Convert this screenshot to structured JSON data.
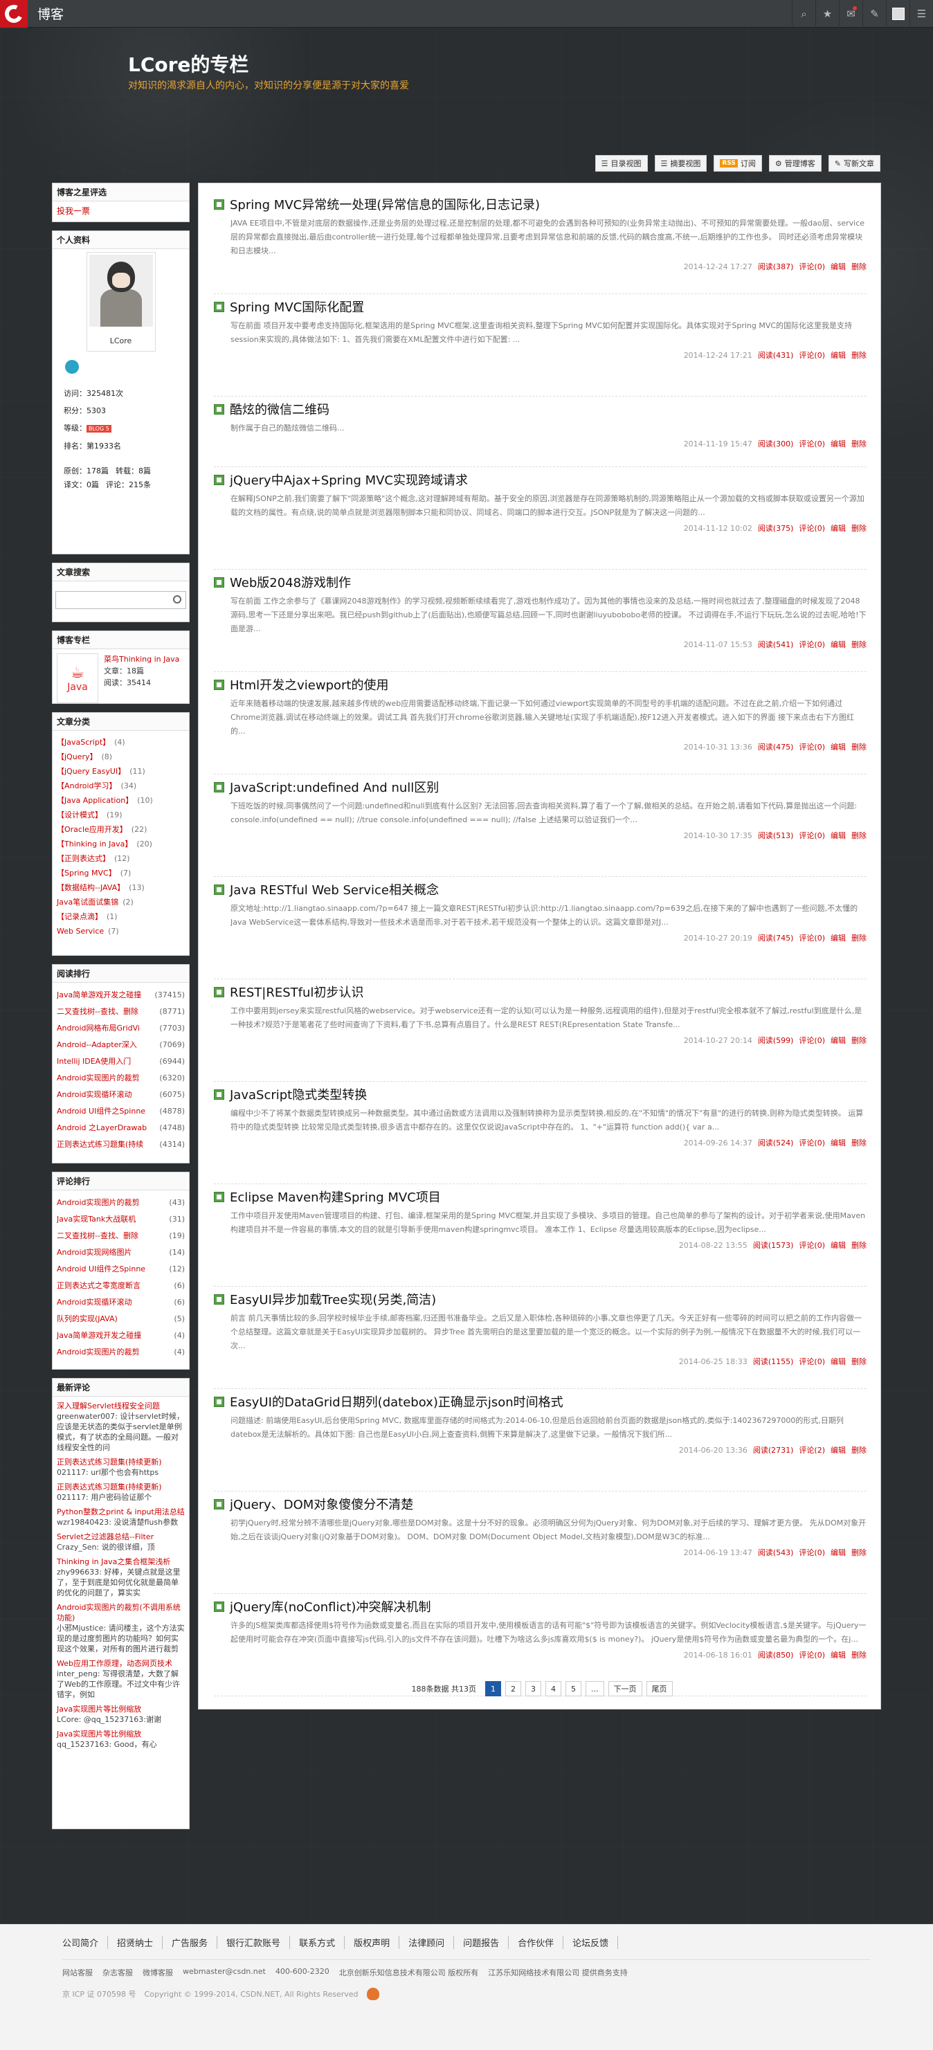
{
  "topbar": {
    "brand": "博客"
  },
  "header": {
    "title": "LCore的专栏",
    "subtitle": "对知识的渴求源自人的内心，对知识的分享便是源于对大家的喜爱"
  },
  "nav": [
    "目录视图",
    "摘要视图",
    "订阅",
    "管理博客",
    "写新文章"
  ],
  "nav_rss": "RSS",
  "side": {
    "award_title": "博客之星评选",
    "award_link": "投我一票",
    "profile_title": "个人资料",
    "username": "LCore",
    "stats": [
      [
        "访问：",
        "325481次"
      ],
      [
        "积分：",
        "5303"
      ],
      [
        "等级：",
        "BLOG 5"
      ],
      [
        "排名：",
        "第1933名"
      ]
    ],
    "stats2": [
      [
        "原创：",
        "178篇",
        "转载：",
        "8篇"
      ],
      [
        "译文：",
        "0篇",
        "评论：",
        "215条"
      ]
    ],
    "search_title": "文章搜索",
    "column_title": "博客专栏",
    "column_name": "菜鸟Thinking in Java",
    "column_count": "文章：18篇",
    "column_read": "阅读：35414",
    "column_logo": "Java",
    "cat_title": "文章分类",
    "cats": [
      [
        "【JavaScript】",
        "(4)"
      ],
      [
        "【jQuery】",
        "(8)"
      ],
      [
        "【jQuery EasyUI】",
        "(11)"
      ],
      [
        "【Android学习】",
        "(34)"
      ],
      [
        "【Java Application】",
        "(10)"
      ],
      [
        "【设计模式】",
        "(19)"
      ],
      [
        "【Oracle应用开发】",
        "(22)"
      ],
      [
        "【Thinking in Java】",
        "(20)"
      ],
      [
        "【正则表达式】",
        "(12)"
      ],
      [
        "【Spring MVC】",
        "(7)"
      ],
      [
        "【数据结构--JAVA】",
        "(13)"
      ],
      [
        "Java笔试面试集锦",
        "(2)"
      ],
      [
        "【记录点滴】",
        "(1)"
      ],
      [
        "Web Service",
        "(7)"
      ]
    ],
    "rank_title": "阅读排行",
    "ranks": [
      [
        "Java简单游戏开发之碰撞",
        "(37415)"
      ],
      [
        "二叉查找树--查找、删除",
        "(8771)"
      ],
      [
        "Android网格布局GridVi",
        "(7703)"
      ],
      [
        "Android--Adapter深入",
        "(7069)"
      ],
      [
        "Intellij IDEA使用入门",
        "(6944)"
      ],
      [
        "Android实现图片的裁剪",
        "(6320)"
      ],
      [
        "Android实现循环滚动",
        "(6075)"
      ],
      [
        "Android UI组件之Spinne",
        "(4878)"
      ],
      [
        "Android 之LayerDrawab",
        "(4748)"
      ],
      [
        "正则表达式练习题集(持续",
        "(4314)"
      ]
    ],
    "crank_title": "评论排行",
    "cranks": [
      [
        "Android实现图片的裁剪",
        "(43)"
      ],
      [
        "Java实现Tank大战联机",
        "(31)"
      ],
      [
        "二叉查找树--查找、删除",
        "(19)"
      ],
      [
        "Android实现网络图片",
        "(14)"
      ],
      [
        "Android UI组件之Spinne",
        "(12)"
      ],
      [
        "正则表达式之零宽度断言",
        "(6)"
      ],
      [
        "Android实现循环滚动",
        "(6)"
      ],
      [
        "队列的实现(JAVA)",
        "(5)"
      ],
      [
        "Java简单游戏开发之碰撞",
        "(4)"
      ],
      [
        "Android实现图片的裁剪",
        "(4)"
      ]
    ],
    "cmt_title": "最新评论",
    "comments": [
      [
        "深入理解Servlet线程安全问题",
        "greenwater007: 设计servlet时候，应该是无状态的类似于servlet是单例模式，有了状态的全局问题。一般对线程安全性的问"
      ],
      [
        "正则表达式练习题集(持续更新)",
        "021117: url那个也会有https"
      ],
      [
        "正则表达式练习题集(持续更新)",
        "021117: 用户密码验证那个"
      ],
      [
        "Python整数之print & input用法总结",
        "wzr19840423: 没说清楚flush参数"
      ],
      [
        "Servlet之过滤器总结--Filter",
        "Crazy_Sen: 说的很详细，顶"
      ],
      [
        "Thinking in Java之集合框架浅析",
        "zhy996633: 好棒，关键点就是这里了，至于到底是如何优化就是最简单的优化的问题了，算实实"
      ],
      [
        "Android实现图片的裁剪(不调用系统功能)",
        "小邪Mjustice: 请问楼主，这个方法实现的是过度剪图片的功能吗？如何实现这个效果，对所有的图片进行裁剪"
      ],
      [
        "Web应用工作原理，动态网页技术",
        "inter_peng: 写得很清楚，大数了解了Web的工作原理。不过文中有少许错字，例如"
      ],
      [
        "Java实现图片等比例缩放",
        "LCore: @qq_15237163:谢谢"
      ],
      [
        "Java实现图片等比例缩放",
        "qq_15237163: Good，有心"
      ]
    ]
  },
  "articles": [
    {
      "title": "Spring MVC异常统一处理(异常信息的国际化,日志记录)",
      "excerpt": "JAVA EE项目中,不管是对底层的数据操作,还是业务层的处理过程,还是控制层的处理,都不可避免的会遇到各种可预知的(业务异常主动抛出)、不可预知的异常需要处理。一般dao层、service层的异常都会直接抛出,最后由controller统一进行处理,每个过程都单独处理异常,且要考虑到异常信息和前端的反馈,代码的耦合度高,不统一,后期维护的工作也多。     同时还必须考虑异常模块和日志模块...",
      "date": "2014-12-24 17:27",
      "read": "阅读(387)",
      "comment": "评论(0)"
    },
    {
      "title": "Spring MVC国际化配置",
      "excerpt": "写在前面       项目开发中要考虑支持国际化,框架选用的是Spring MVC框架,这里查询相关资料,整理下Spring MVC如何配置并实现国际化。具体实现对于Spring MVC的国际化这里我是支持session来实现的,具体做法如下:       1、首先我们需要在XML配置文件中进行如下配置: ...",
      "date": "2014-12-24 17:21",
      "read": "阅读(431)",
      "comment": "评论(0)"
    },
    {
      "title": "酷炫的微信二维码",
      "excerpt": "制作属于自己的酷炫微信二维码...",
      "date": "2014-11-19 15:47",
      "read": "阅读(300)",
      "comment": "评论(0)"
    },
    {
      "title": "jQuery中Ajax+Spring MVC实现跨域请求",
      "excerpt": "在解释JSONP之前,我们需要了解下\"同源策略\"这个概念,这对理解跨域有帮助。基于安全的原因,浏览器是存在同源策略机制的,同源策略阻止从一个源加载的文档或脚本获取或设置另一个源加载的文档的属性。有点绕,说的简单点就是浏览器限制脚本只能和同协议、同域名、同端口的脚本进行交互。JSONP就是为了解决这一问题的...",
      "date": "2014-11-12 10:02",
      "read": "阅读(375)",
      "comment": "评论(0)"
    },
    {
      "title": "Web版2048游戏制作",
      "excerpt": "写在前面         工作之余参与了《慕课网2048游戏制作》的学习视频,视频断断续续看完了,游戏也制作成功了。因为其他的事情也没来的及总结,一拖时间也就过去了,整理磁盘的时候发现了2048源码,思考一下还是分享出来吧。我已经push到github上了(后面贴出),也顺便写篇总结,回顾一下,同时也谢谢liuyubobobo老师的授课。       不过调得在手,不运行下玩玩,怎么说的过去呢,哈哈!下面是游...",
      "date": "2014-11-07 15:53",
      "read": "阅读(541)",
      "comment": "评论(0)"
    },
    {
      "title": "Html开发之viewport的使用",
      "excerpt": "近年来随着移动端的快速发展,越来越多传统的web应用需要适配移动终端,下面记录一下如何通过viewport实现简单的不同型号的手机端的适配问题。不过在此之前,介绍一下如何通过Chrome浏览器,调试在移动终端上的效果。调试工具       首先我们打开chrome谷歌浏览器,输入关键地址(实现了手机端适配),按F12进入开发者模式。进入如下的界面       接下来点击右下方图红的...",
      "date": "2014-10-31 13:36",
      "read": "阅读(475)",
      "comment": "评论(0)"
    },
    {
      "title": "JavaScript:undefined And null区别",
      "excerpt": "下班吃饭的时候,同事偶然问了一个问题:undefined和null到底有什么区别? 无法回答,回去查询相关资料,算了看了一个了解,做相关的总结。在开始之前,请看如下代码,算是抛出这一个问题: console.info(undefined == null); //true console.info(undefined === null); //false       上述结果可以验证我们一个...",
      "date": "2014-10-30 17:35",
      "read": "阅读(513)",
      "comment": "评论(0)"
    },
    {
      "title": "Java RESTful Web Service相关概念",
      "excerpt": "原文地址:http://1.liangtao.sinaapp.com/?p=647       接上一篇文章REST|RESTful初步认识:http://1.liangtao.sinaapp.com/?p=639之后,在接下来的了解中也遇到了一些问题,不太懂的Java WebService这一套体系结构,导致对一些技术术语是而非,对于若干技术,若干规范没有一个整体上的认识。这篇文章即是对J...",
      "date": "2014-10-27 20:19",
      "read": "阅读(745)",
      "comment": "评论(0)"
    },
    {
      "title": "REST|RESTful初步认识",
      "excerpt": "工作中要用到jersey来实现restful风格的webservice。对于webservice还有一定的认知(可以认为是一种服务,远程调用的组件),但是对于restful完全根本就不了解过,restful到底是什么,是一种技术?规范?于是笔者花了些时间查询了下资料,看了下书,总算有点眉目了。什么是REST REST(REpresentation State Transfe...",
      "date": "2014-10-27 20:14",
      "read": "阅读(599)",
      "comment": "评论(0)"
    },
    {
      "title": "JavaScript隐式类型转换",
      "excerpt": "编程中少不了将某个数据类型转换成另一种数据类型。其中通过函数或方法调用以及强制转换称为显示类型转换,相反的,在\"不知情\"的情况下\"有意\"的进行的转换,则称为隐式类型转换。     运算符中的隐式类型转换       比较常见隐式类型转换,很多语言中都存在的。这里仅仅说说JavaScript中存在的。         1、\"+\"运算符 function add(){ var a...",
      "date": "2014-09-26 14:37",
      "read": "阅读(524)",
      "comment": "评论(0)"
    },
    {
      "title": "Eclipse Maven构建Spring MVC项目",
      "excerpt": "工作中项目开发使用Maven管理项目的构建、打包、编译,框架采用的是Spring MVC框架,并且实现了多模块、多项目的管理。自己也简单的参与了架构的设计。对于初学者来说,使用Maven构建项目并不是一件容易的事情,本文的目的就是引导新手使用maven构建springmvc项目。 准本工作       1、Eclipse         尽量选用较高版本的Eclipse,因为eclipse...",
      "date": "2014-08-22 13:55",
      "read": "阅读(1573)",
      "comment": "评论(0)"
    },
    {
      "title": "EasyUI异步加载Tree实现(另类,简洁)",
      "excerpt": "前言       前几天事情比较的多,回学校时候毕业手续,邮寄档案,归还图书准备毕业。之后又是入职体检,各种琐碎的小事,文章也停更了几天。今天正好有一些零碎的时间可以把之前的工作内容做一个总结整理。这篇文章就是关于EasyUI实现异步加载树的。     异步Tree       首先需明白的是这里要加载的是一个宽泛的概念。以一个实际的例子为例,一般情况下在数据量不大的时候,我们可以一次...",
      "date": "2014-06-25 18:33",
      "read": "阅读(1155)",
      "comment": "评论(0)"
    },
    {
      "title": "EasyUI的DataGrid日期列(datebox)正确显示json时间格式",
      "excerpt": "问题描述:       前端使用EasyUI,后台使用Spring MVC, 数据库里面存储的时间格式为:2014-06-10,但是后台返回给前台页面的数据是json格式的,类似于:1402367297000的形式,日期列datebox是无法解析的。具体如下图:       自己也是EasyUI小白,网上查查资料,倒腾下来算是解决了,这里做下记录。一般情况下我们所...",
      "date": "2014-06-20 13:36",
      "read": "阅读(2731)",
      "comment": "评论(2)"
    },
    {
      "title": "jQuery、DOM对象傻傻分不清楚",
      "excerpt": "初学jQuery时,经常分辨不清哪些是jQuery对象,哪些是DOM对象。这是十分不好的现象。必须明确区分何为jQuery对象、何为DOM对象,对于后续的学习、理解才更方便。       先从DOM对象开始,之后在谈谈jQuery对象(jQ对象基于DOM对象)。     DOM、DOM对象           DOM(Document Object Model,文档对象模型),DOM是W3C的标准...",
      "date": "2014-06-19 13:47",
      "read": "阅读(543)",
      "comment": "评论(0)"
    },
    {
      "title": "jQuery库(noConflict)冲突解决机制",
      "excerpt": "许多的JS框架类库都选择使用$符号作为函数或变量名,而且在实际的项目开发中,使用模板语言的话有可能\"$\"符号即为该模板语言的关键字。例如Veclocity模板语言,$是关键字。与jQuery一起使用时可能会存在冲突(页面中直接写js代码,引入的js文件不存在该问题)。吐槽下为啥这么多js库喜欢用$($ is money?)。       jQuery是使用$符号作为函数或变量名最为典型的一个。在j...",
      "date": "2014-06-18 16:01",
      "read": "阅读(850)",
      "comment": "评论(0)"
    }
  ],
  "article_edit": "编辑",
  "article_delete": "删除",
  "pager": {
    "summary": "188条数据 共13页",
    "pages": [
      "1",
      "2",
      "3",
      "4",
      "5",
      "...",
      "下一页",
      "尾页"
    ]
  },
  "footer": {
    "links": [
      "公司简介",
      "招贤纳士",
      "广告服务",
      "银行汇款账号",
      "联系方式",
      "版权声明",
      "法律顾问",
      "问题报告",
      "合作伙伴",
      "论坛反馈"
    ],
    "contact": [
      "网站客服",
      "杂志客服",
      "微博客服",
      "webmaster@csdn.net",
      "400-600-2320",
      "北京创新乐知信息技术有限公司 版权所有",
      "江苏乐知网络技术有限公司 提供商务支持"
    ],
    "copyright": [
      "京 ICP 证 070598 号",
      "Copyright © 1999-2014, CSDN.NET, All Rights Reserved"
    ]
  }
}
